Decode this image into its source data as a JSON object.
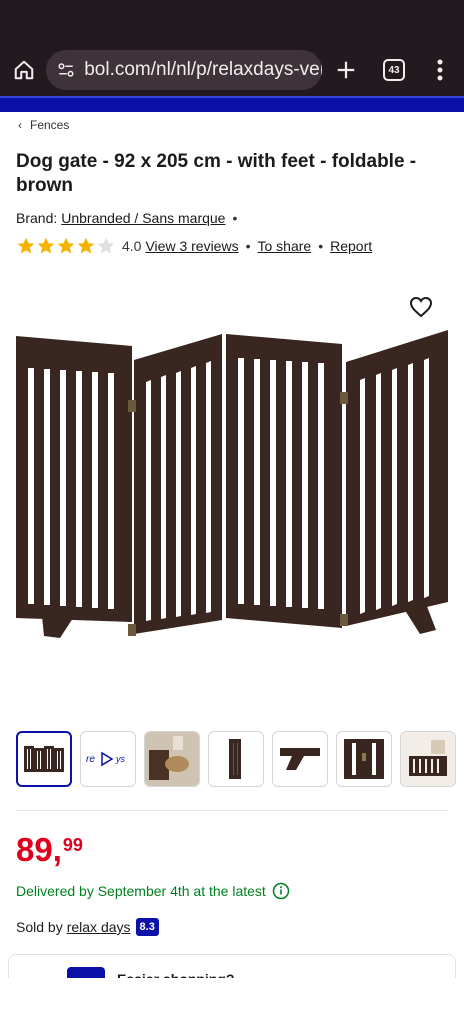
{
  "browser": {
    "url": "bol.com/nl/nl/p/relaxdays-veilig",
    "tab_count": "43",
    "home_icon": "home-icon",
    "site_settings_icon": "site-settings-icon",
    "new_tab_icon": "plus-icon",
    "menu_icon": "more-vert-icon"
  },
  "breadcrumb": {
    "label": "Fences"
  },
  "product": {
    "title": "Dog gate - 92 x 205 cm - with feet - foldable - brown",
    "brand_label": "Brand:",
    "brand_name": "Unbranded / Sans marque",
    "rating_value": "4.0",
    "rating_stars": 4,
    "reviews_link": "View 3 reviews",
    "share_link": "To share",
    "report_link": "Report"
  },
  "pricing": {
    "whole": "89,",
    "fraction": "99",
    "delivery": "Delivered by September 4th at the latest",
    "seller_label": "Sold by",
    "seller_name": "relax days",
    "seller_score": "8.3"
  },
  "thumbnails": [
    "gate-main",
    "video-preview",
    "lifestyle-photo",
    "side-view",
    "foot-detail",
    "hinge-detail",
    "room-setup"
  ],
  "promo": {
    "text": "Easier shopping?"
  },
  "colors": {
    "browser_bg": "#231a20",
    "brand_blue": "#0b10a8",
    "price_red": "#e0001b",
    "delivery_green": "#00811f",
    "star_gold": "#f5b400",
    "gate_brown": "#3a2620"
  }
}
